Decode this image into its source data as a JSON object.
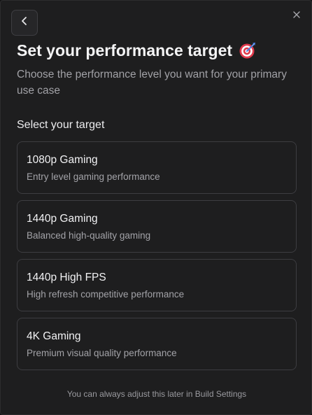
{
  "dialog": {
    "title": "Set your performance target",
    "title_icon": "target-dart-icon",
    "subtitle": "Choose the performance level you want for your primary use case",
    "section_label": "Select your target",
    "footer": "You can always adjust this later in Build Settings"
  },
  "options": [
    {
      "title": "1080p Gaming",
      "description": "Entry level gaming performance"
    },
    {
      "title": "1440p Gaming",
      "description": "Balanced high-quality gaming"
    },
    {
      "title": "1440p High FPS",
      "description": "High refresh competitive performance"
    },
    {
      "title": "4K Gaming",
      "description": "Premium visual quality performance"
    }
  ],
  "colors": {
    "background": "#1e1e1f",
    "card_border": "#3d3d41",
    "text_primary": "#f4f4f5",
    "text_secondary": "#a1a1a6",
    "target_red": "#e0394b",
    "dart_blue": "#4a7fe0"
  },
  "icons": {
    "back": "chevron-left-icon",
    "close": "close-icon"
  }
}
